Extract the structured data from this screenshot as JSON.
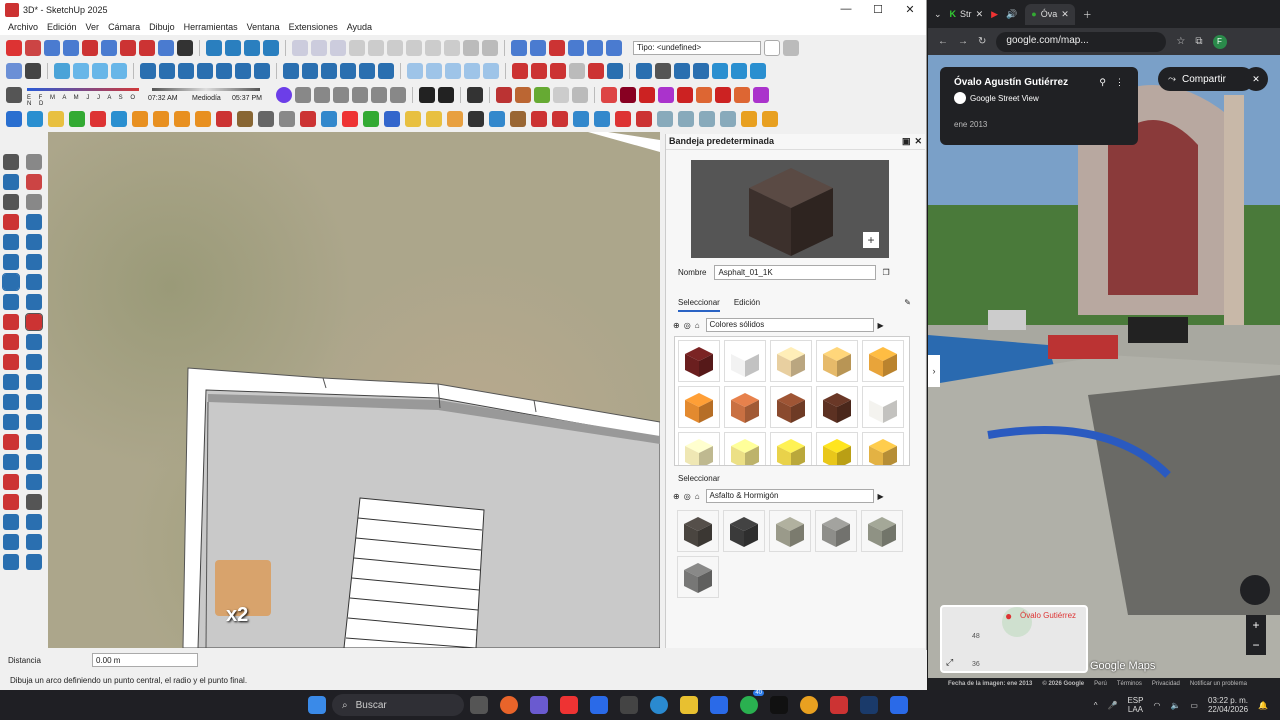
{
  "sketchup": {
    "title": "3D* - SketchUp 2025",
    "menu": [
      "Archivo",
      "Edición",
      "Ver",
      "Cámara",
      "Dibujo",
      "Herramientas",
      "Ventana",
      "Extensiones",
      "Ayuda"
    ],
    "tipo_label": "Tipo: <undefined>",
    "shadow": {
      "months": "E F M A M J J A S O N D",
      "time_start": "07:32 AM",
      "mid_label": "Mediodía",
      "time_end": "05:37 PM"
    },
    "viewport_badge": "x2",
    "tray": {
      "title": "Bandeja predeterminada",
      "name_label": "Nombre",
      "name_value": "Asphalt_01_1K",
      "tab_select": "Seleccionar",
      "tab_edit": "Edición",
      "library_1": "Colores sólidos",
      "section2_label": "Seleccionar",
      "library_2": "Asfalto & Hormigón",
      "solid_colors": [
        "#6b1f1f",
        "#f2f2f2",
        "#e8cfa0",
        "#e6ba6a",
        "#e8a43a",
        "#e38a2f",
        "#c97042",
        "#8a4a2e",
        "#5c3122",
        "#f4f3ef",
        "#efe7b4",
        "#ece086",
        "#e9d24a",
        "#e9c71a",
        "#e3b243"
      ],
      "asphalt_colors": [
        "#4a4540",
        "#3a3a3a",
        "#9a9a8a",
        "#8e8e8a",
        "#8f9284",
        "#777776"
      ]
    },
    "status": {
      "distance_label": "Distancia",
      "distance_value": "0.00 m",
      "hint": "Dibuja un arco definiendo un punto central, el radio y el punto final."
    }
  },
  "browser": {
    "tabs": [
      "Str",
      "Óva"
    ],
    "url": "google.com/map...",
    "card": {
      "title": "Óvalo Agustín Gutiérrez",
      "subtitle": "Google Street View",
      "date": "ene 2013"
    },
    "share_label": "Compartir",
    "minimap_label": "Óvalo Gutiérrez",
    "footer": [
      "Fecha de la imagen: ene 2013",
      "© 2026 Google",
      "Perú",
      "Términos",
      "Privacidad",
      "Notificar un problema"
    ],
    "watermark": "Google Maps",
    "map_numbers": [
      "48",
      "36"
    ]
  },
  "taskbar": {
    "search": "Buscar",
    "lang1": "ESP",
    "lang2": "LAA",
    "time": "03:22 p. m.",
    "date": "22/04/2026",
    "badge": "40"
  }
}
